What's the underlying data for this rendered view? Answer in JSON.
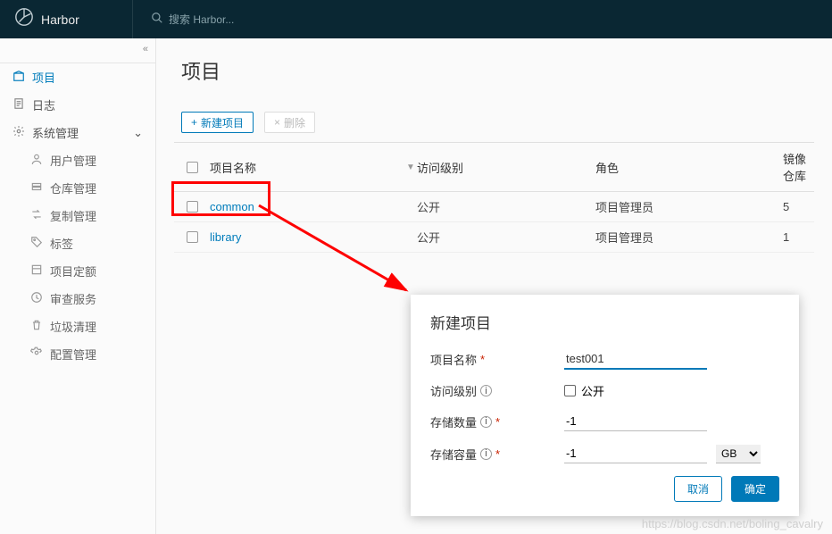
{
  "brand": {
    "name": "Harbor"
  },
  "search": {
    "placeholder": "搜索 Harbor..."
  },
  "sidebar": {
    "items": [
      {
        "label": "项目",
        "icon": "projects"
      },
      {
        "label": "日志",
        "icon": "logs"
      },
      {
        "label": "系统管理",
        "icon": "admin",
        "expandable": true
      }
    ],
    "subitems": [
      {
        "label": "用户管理"
      },
      {
        "label": "仓库管理"
      },
      {
        "label": "复制管理"
      },
      {
        "label": "标签"
      },
      {
        "label": "项目定额"
      },
      {
        "label": "审查服务"
      },
      {
        "label": "垃圾清理"
      },
      {
        "label": "配置管理"
      }
    ]
  },
  "page": {
    "title": "项目"
  },
  "toolbar": {
    "new_project": "新建项目",
    "delete": "删除"
  },
  "table": {
    "headers": {
      "name": "项目名称",
      "access": "访问级别",
      "role": "角色",
      "repo": "镜像仓库"
    },
    "rows": [
      {
        "name": "common",
        "access": "公开",
        "role": "项目管理员",
        "repo": "5"
      },
      {
        "name": "library",
        "access": "公开",
        "role": "项目管理员",
        "repo": "1"
      }
    ]
  },
  "modal": {
    "title": "新建项目",
    "fields": {
      "name_label": "项目名称",
      "name_value": "test001",
      "access_label": "访问级别",
      "access_option": "公开",
      "count_label": "存储数量",
      "count_value": "-1",
      "cap_label": "存储容量",
      "cap_value": "-1",
      "cap_unit": "GB"
    },
    "cancel": "取消",
    "confirm": "确定"
  },
  "watermark": "https://blog.csdn.net/boling_cavalry"
}
